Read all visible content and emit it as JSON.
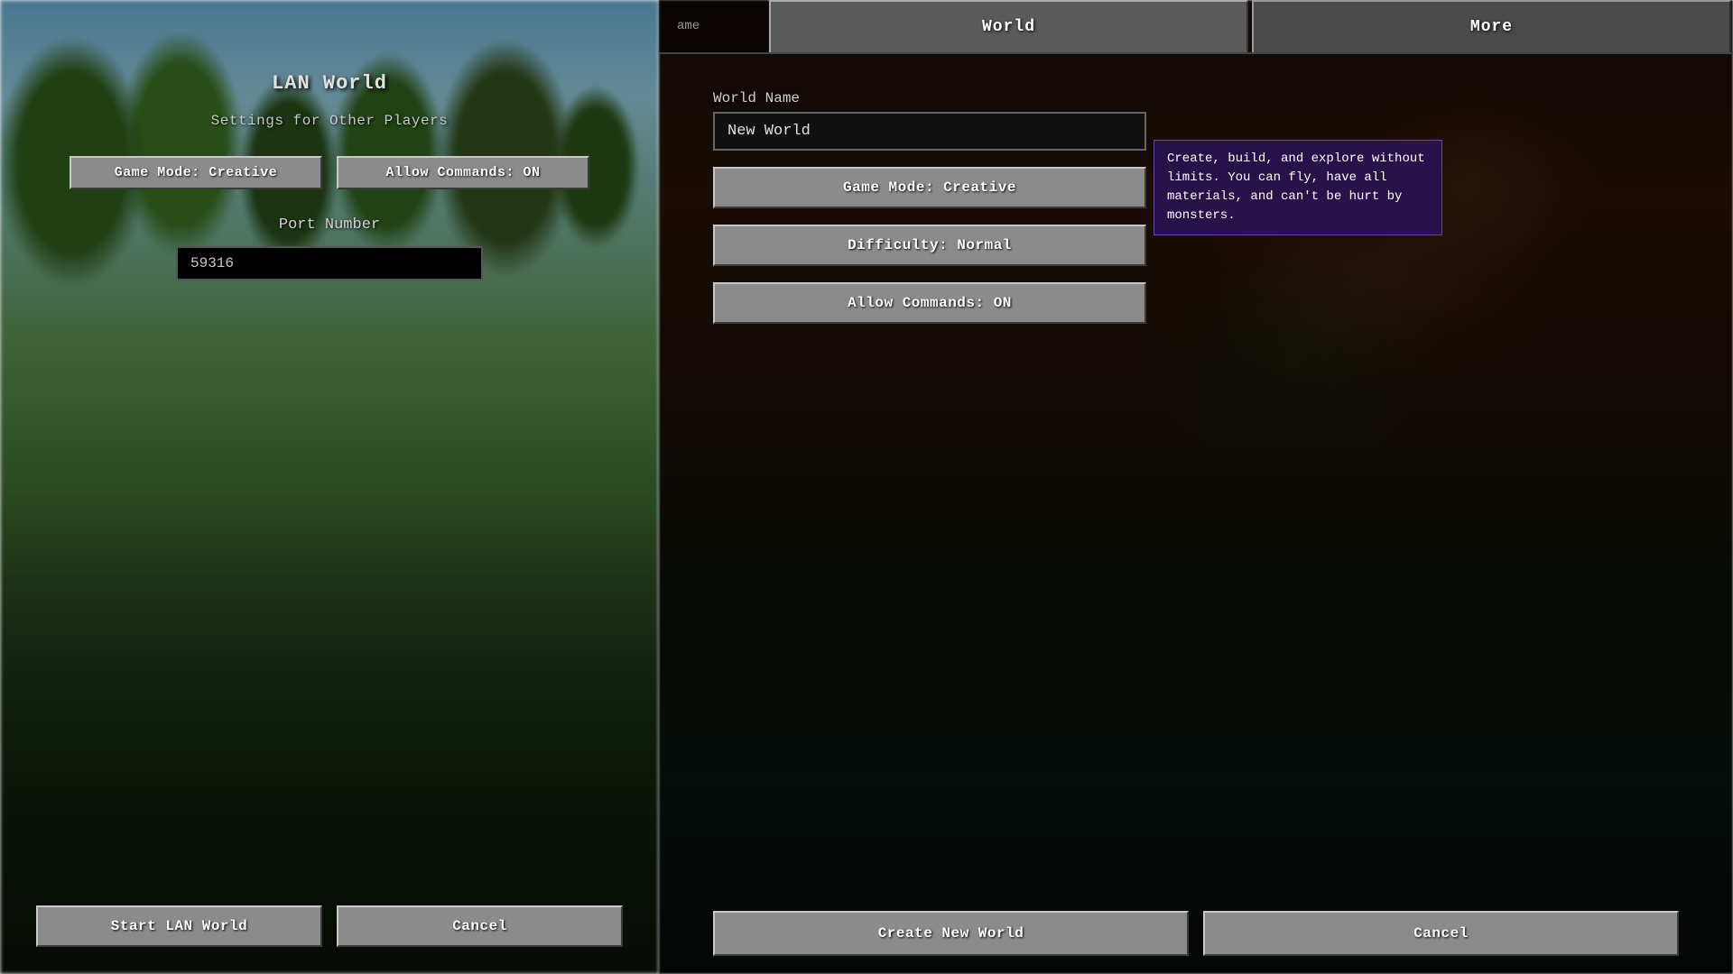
{
  "left": {
    "title": "LAN World",
    "subtitle": "Settings for Other Players",
    "game_mode_button": "Game Mode: Creative",
    "allow_commands_button": "Allow Commands: ON",
    "port_label": "Port Number",
    "port_value": "59316",
    "start_button": "Start LAN World",
    "cancel_button": "Cancel"
  },
  "right": {
    "tab_game": "ame",
    "tab_world": "World",
    "tab_more": "More",
    "world_name_label": "World Name",
    "world_name_value": "New World",
    "game_mode_button": "Game Mode: Creative",
    "difficulty_button": "Difficulty: Normal",
    "allow_commands_button": "Allow Commands: ON",
    "tooltip_text": "Create, build, and explore without limits. You can fly, have all materials, and can't be hurt by monsters.",
    "create_button": "Create New World",
    "cancel_button": "Cancel"
  },
  "colors": {
    "mc_button_bg": "#8b8b8b",
    "tooltip_bg": "rgba(40,20,80,0.92)",
    "tooltip_border": "#6644aa"
  }
}
